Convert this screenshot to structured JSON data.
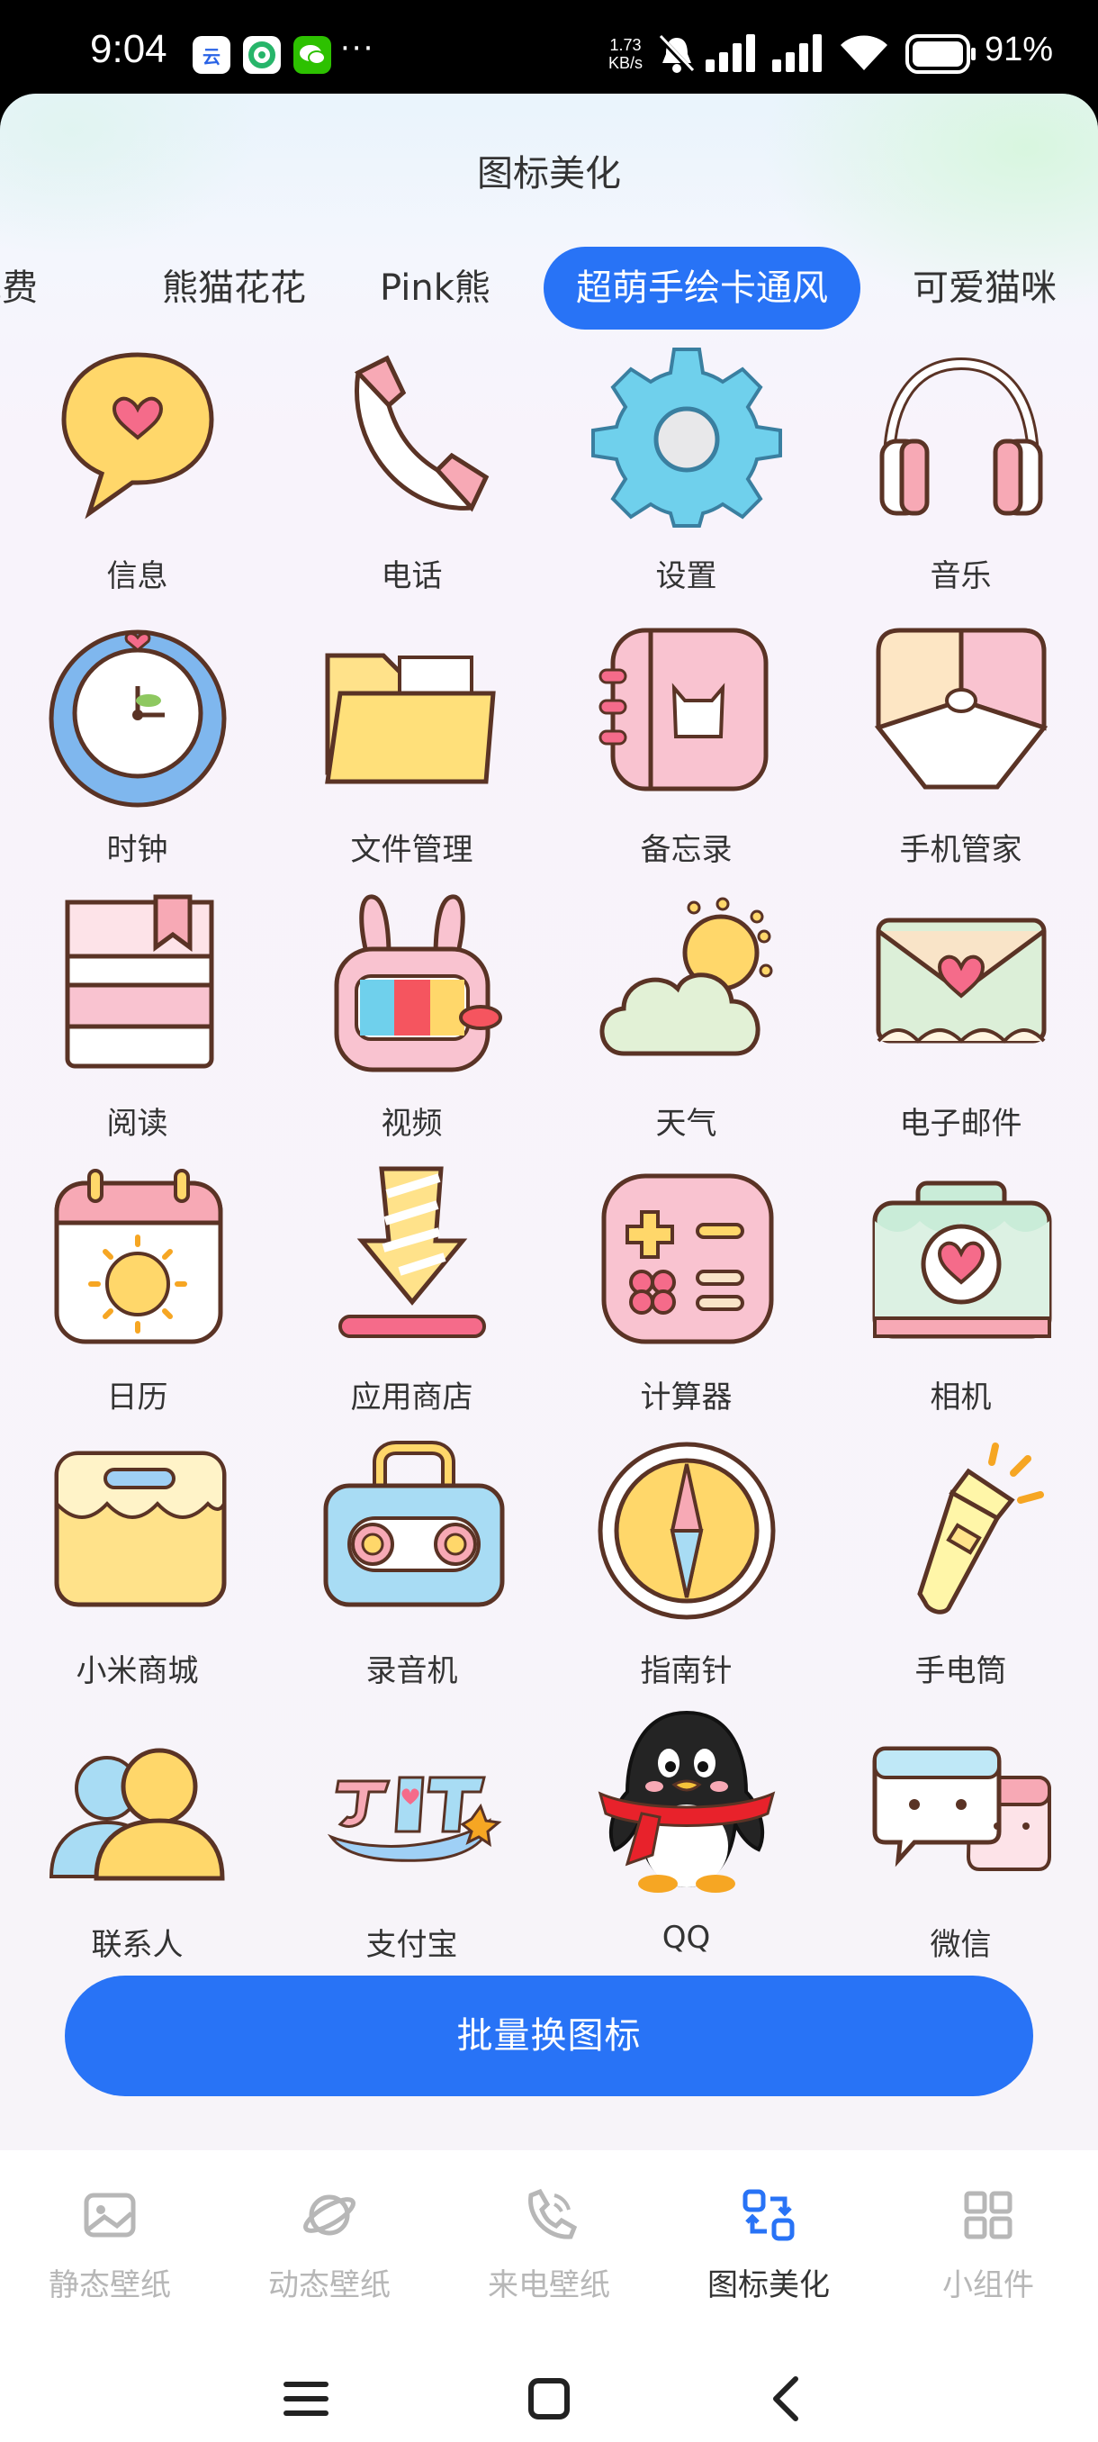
{
  "status_bar": {
    "time": "9:04",
    "notifications": [
      {
        "icon": "cloud-app-icon",
        "text": "云",
        "color": "#2a63e6"
      },
      {
        "icon": "recycle-app-icon",
        "text": "",
        "color": "#27b56a"
      },
      {
        "icon": "wechat-icon",
        "text": "",
        "color": "#2dc100"
      }
    ],
    "more": "···",
    "net_speed_value": "1.73",
    "net_speed_unit": "KB/s",
    "battery": "91%"
  },
  "header": {
    "title": "图标美化"
  },
  "tabs": [
    {
      "label": "免费",
      "active": false
    },
    {
      "label": "熊猫花花",
      "active": false
    },
    {
      "label": "Pink熊",
      "active": false
    },
    {
      "label": "超萌手绘卡通风",
      "active": true
    },
    {
      "label": "可爱猫咪",
      "active": false
    }
  ],
  "icons": [
    {
      "label": "信息",
      "icon": "message-bubble-heart-icon"
    },
    {
      "label": "电话",
      "icon": "phone-handset-icon"
    },
    {
      "label": "设置",
      "icon": "gear-icon"
    },
    {
      "label": "音乐",
      "icon": "headphones-icon"
    },
    {
      "label": "时钟",
      "icon": "clock-icon"
    },
    {
      "label": "文件管理",
      "icon": "folder-icon"
    },
    {
      "label": "备忘录",
      "icon": "notebook-cat-icon"
    },
    {
      "label": "手机管家",
      "icon": "phone-manager-icon"
    },
    {
      "label": "阅读",
      "icon": "book-bookmark-icon"
    },
    {
      "label": "视频",
      "icon": "bunny-tv-icon"
    },
    {
      "label": "天气",
      "icon": "cloud-sun-icon"
    },
    {
      "label": "电子邮件",
      "icon": "envelope-heart-icon"
    },
    {
      "label": "日历",
      "icon": "calendar-sun-icon"
    },
    {
      "label": "应用商店",
      "icon": "download-arrow-icon"
    },
    {
      "label": "计算器",
      "icon": "calculator-gamepad-icon"
    },
    {
      "label": "相机",
      "icon": "camera-heart-icon"
    },
    {
      "label": "小米商城",
      "icon": "shopping-bag-icon"
    },
    {
      "label": "录音机",
      "icon": "recorder-icon"
    },
    {
      "label": "指南针",
      "icon": "compass-icon"
    },
    {
      "label": "手电筒",
      "icon": "flashlight-icon"
    },
    {
      "label": "联系人",
      "icon": "contacts-icon"
    },
    {
      "label": "支付宝",
      "icon": "alipay-icon"
    },
    {
      "label": "QQ",
      "icon": "qq-penguin-icon"
    },
    {
      "label": "微信",
      "icon": "wechat-bubbles-icon"
    }
  ],
  "batch_button": {
    "label": "批量换图标"
  },
  "bottom_nav": [
    {
      "label": "静态壁纸",
      "icon": "image-icon",
      "active": false
    },
    {
      "label": "动态壁纸",
      "icon": "planet-icon",
      "active": false
    },
    {
      "label": "来电壁纸",
      "icon": "phone-ring-icon",
      "active": false
    },
    {
      "label": "图标美化",
      "icon": "icon-swap-icon",
      "active": true
    },
    {
      "label": "小组件",
      "icon": "widgets-grid-icon",
      "active": false
    }
  ],
  "colors": {
    "accent": "#2873f6",
    "inactive_nav": "#b7b7b7",
    "text": "#333333"
  }
}
